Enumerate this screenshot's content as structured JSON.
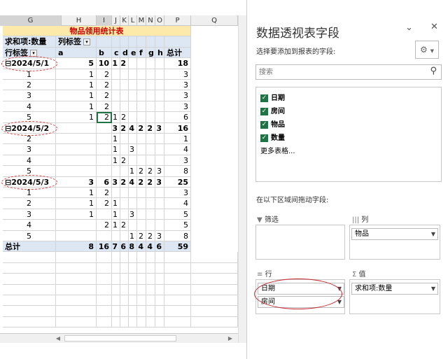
{
  "columns": [
    {
      "name": "G",
      "selected": true
    },
    {
      "name": "H"
    },
    {
      "name": "I",
      "selected": true
    },
    {
      "name": "J"
    },
    {
      "name": "K"
    },
    {
      "name": "L"
    },
    {
      "name": "M"
    },
    {
      "name": "N"
    },
    {
      "name": "O"
    },
    {
      "name": "P"
    },
    {
      "name": "Q"
    }
  ],
  "sheet": {
    "title": "物品领用统计表",
    "value_header": "求和项:数量",
    "col_label_header": "列标签",
    "row_label_header": "行标签",
    "col_items": [
      "a",
      "b",
      "c",
      "d",
      "e",
      "f",
      "g",
      "h",
      "总计"
    ],
    "rows": [
      {
        "label": "⊟2024/5/1",
        "level": 1,
        "vals": [
          "5",
          "10",
          "1",
          "2",
          "",
          "",
          "",
          "",
          "18"
        ]
      },
      {
        "label": "1",
        "level": 2,
        "vals": [
          "1",
          "2",
          "",
          "",
          "",
          "",
          "",
          "",
          "3"
        ]
      },
      {
        "label": "2",
        "level": 2,
        "vals": [
          "1",
          "2",
          "",
          "",
          "",
          "",
          "",
          "",
          "3"
        ]
      },
      {
        "label": "3",
        "level": 2,
        "vals": [
          "1",
          "2",
          "",
          "",
          "",
          "",
          "",
          "",
          "3"
        ]
      },
      {
        "label": "4",
        "level": 2,
        "vals": [
          "1",
          "2",
          "",
          "",
          "",
          "",
          "",
          "",
          "3"
        ]
      },
      {
        "label": "5",
        "level": 2,
        "vals": [
          "1",
          "2",
          "1",
          "2",
          "",
          "",
          "",
          "",
          "6"
        ]
      },
      {
        "label": "⊟2024/5/2",
        "level": 1,
        "vals": [
          "",
          "",
          "3",
          "2",
          "4",
          "2",
          "2",
          "3",
          "16"
        ]
      },
      {
        "label": "2",
        "level": 2,
        "vals": [
          "",
          "",
          "1",
          "",
          "",
          "",
          "",
          "",
          "1"
        ]
      },
      {
        "label": "3",
        "level": 2,
        "vals": [
          "",
          "",
          "1",
          "",
          "3",
          "",
          "",
          "",
          "4"
        ]
      },
      {
        "label": "4",
        "level": 2,
        "vals": [
          "",
          "",
          "1",
          "2",
          "",
          "",
          "",
          "",
          "3"
        ]
      },
      {
        "label": "5",
        "level": 2,
        "vals": [
          "",
          "",
          "",
          "",
          "1",
          "2",
          "2",
          "3",
          "8"
        ]
      },
      {
        "label": "⊟2024/5/3",
        "level": 1,
        "vals": [
          "3",
          "6",
          "3",
          "2",
          "4",
          "2",
          "2",
          "3",
          "25"
        ]
      },
      {
        "label": "1",
        "level": 2,
        "vals": [
          "1",
          "2",
          "",
          "",
          "",
          "",
          "",
          "",
          "3"
        ]
      },
      {
        "label": "2",
        "level": 2,
        "vals": [
          "1",
          "2",
          "1",
          "",
          "",
          "",
          "",
          "",
          "4"
        ]
      },
      {
        "label": "3",
        "level": 2,
        "vals": [
          "1",
          "",
          "1",
          "",
          "3",
          "",
          "",
          "",
          "5"
        ]
      },
      {
        "label": "4",
        "level": 2,
        "vals": [
          "",
          "2",
          "1",
          "2",
          "",
          "",
          "",
          "",
          "5"
        ]
      },
      {
        "label": "5",
        "level": 2,
        "vals": [
          "",
          "",
          "",
          "",
          "1",
          "2",
          "2",
          "3",
          "8"
        ]
      }
    ],
    "grand_total": {
      "label": "总计",
      "vals": [
        "8",
        "16",
        "7",
        "6",
        "8",
        "4",
        "4",
        "6",
        "59"
      ]
    }
  },
  "pane": {
    "title": "数据透视表字段",
    "choose_label": "选择要添加到报表的字段:",
    "search_placeholder": "搜索",
    "fields": [
      "日期",
      "房间",
      "物品",
      "数量"
    ],
    "more_tables": "更多表格...",
    "drag_label": "在以下区域间拖动字段:",
    "filters_label": "筛选",
    "columns_label": "列",
    "rows_label": "行",
    "values_label": "值",
    "column_field": "物品",
    "row_fields": [
      "日期",
      "房间"
    ],
    "value_field": "求和项:数量"
  },
  "colors": {
    "accent": "#217346",
    "title_fill": "#fde9a9",
    "title_text": "#c00000",
    "header_fill": "#dde6f3",
    "annotation": "#c9252c"
  }
}
